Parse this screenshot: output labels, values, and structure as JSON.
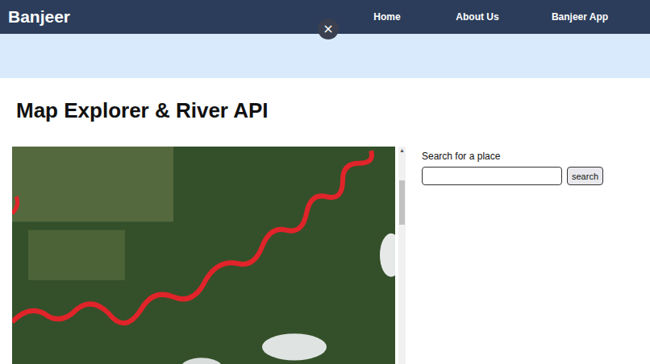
{
  "header": {
    "logo": "Banjeer",
    "nav": [
      {
        "label": "Home",
        "selected": false
      },
      {
        "label": "About Us",
        "selected": false
      },
      {
        "label": "Banjeer App",
        "selected": false
      }
    ],
    "close_button": "×"
  },
  "page": {
    "title": "Map Explorer & River API"
  },
  "map": {
    "scrollbar": {
      "up_arrow": "▴",
      "level": 0.12
    }
  },
  "search": {
    "label": "Search for a place",
    "placeholder": "",
    "button": "search"
  }
}
